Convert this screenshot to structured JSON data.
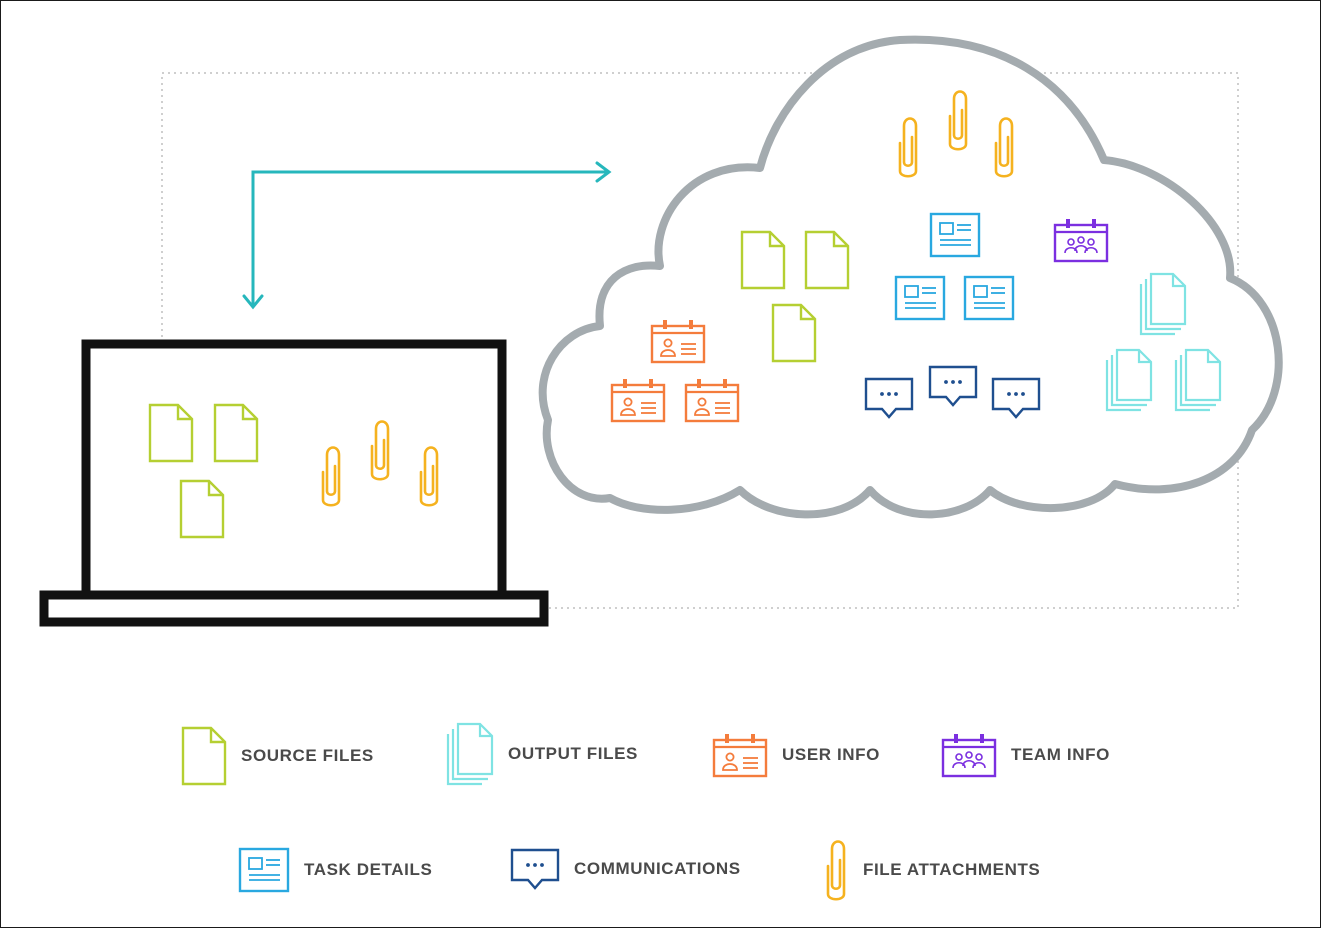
{
  "colors": {
    "source_files": "#b5cf32",
    "output_files": "#7fe3e3",
    "user_info": "#f47c3c",
    "team_info": "#7b2fe0",
    "task_details": "#29a8e0",
    "communications": "#1f4f8f",
    "file_attachments": "#f5b21f",
    "cloud_outline": "#a4abaf",
    "arrow": "#26b7bc",
    "laptop": "#111111",
    "dotted_box": "#cfcfcf"
  },
  "legend": {
    "source_files": {
      "label": "SOURCE FILES",
      "icon": "document-icon"
    },
    "output_files": {
      "label": "OUTPUT FILES",
      "icon": "stacked-documents-icon"
    },
    "user_info": {
      "label": "USER INFO",
      "icon": "user-card-icon"
    },
    "team_info": {
      "label": "TEAM INFO",
      "icon": "team-card-icon"
    },
    "task_details": {
      "label": "TASK DETAILS",
      "icon": "task-card-icon"
    },
    "communications": {
      "label": "COMMUNICATIONS",
      "icon": "chat-bubble-icon"
    },
    "file_attachments": {
      "label": "FILE ATTACHMENTS",
      "icon": "paperclip-icon"
    }
  }
}
